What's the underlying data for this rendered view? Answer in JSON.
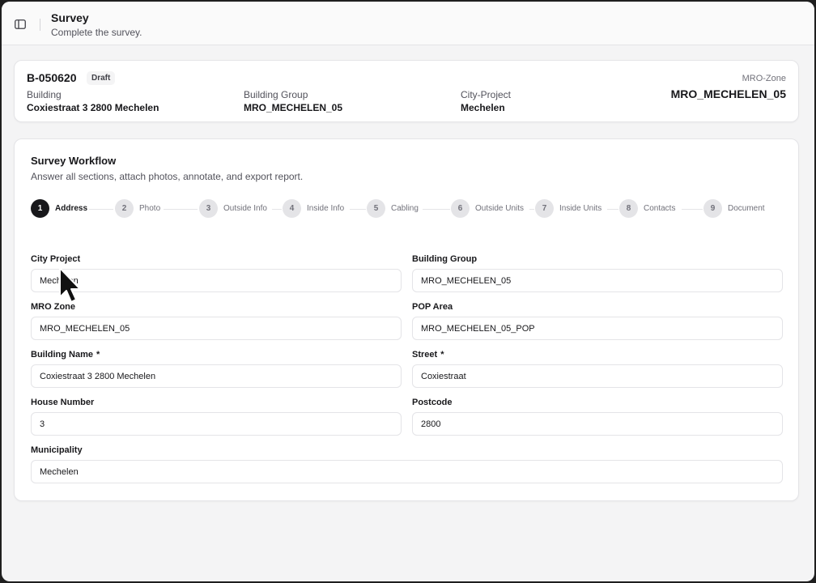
{
  "header": {
    "title": "Survey",
    "subtitle": "Complete the survey.",
    "toggle_icon": "sidebar-toggle-icon"
  },
  "summary": {
    "code": "B-050620",
    "status": "Draft",
    "building_label": "Building",
    "building_value": "Coxiestraat 3 2800 Mechelen",
    "group_label": "Building Group",
    "group_value": "MRO_MECHELEN_05",
    "city_label": "City-Project",
    "city_value": "Mechelen",
    "zone_label": "MRO-Zone",
    "zone_value": "MRO_MECHELEN_05"
  },
  "workflow": {
    "title": "Survey Workflow",
    "subtitle": "Answer all sections, attach photos, annotate, and export report.",
    "steps": [
      {
        "num": "1",
        "label": "Address"
      },
      {
        "num": "2",
        "label": "Photo"
      },
      {
        "num": "3",
        "label": "Outside Info"
      },
      {
        "num": "4",
        "label": "Inside Info"
      },
      {
        "num": "5",
        "label": "Cabling"
      },
      {
        "num": "6",
        "label": "Outside Units"
      },
      {
        "num": "7",
        "label": "Inside Units"
      },
      {
        "num": "8",
        "label": "Contacts"
      },
      {
        "num": "9",
        "label": "Document"
      }
    ],
    "active_step": 1
  },
  "form": {
    "city_project": {
      "label": "City Project",
      "value": "Mechelen"
    },
    "building_group": {
      "label": "Building Group",
      "value": "MRO_MECHELEN_05"
    },
    "mro_zone": {
      "label": "MRO Zone",
      "value": "MRO_MECHELEN_05"
    },
    "pop_area": {
      "label": "POP Area",
      "value": "MRO_MECHELEN_05_POP"
    },
    "building_name": {
      "label": "Building Name",
      "required": "*",
      "value": "Coxiestraat 3 2800 Mechelen"
    },
    "street": {
      "label": "Street",
      "required": "*",
      "value": "Coxiestraat"
    },
    "house_number": {
      "label": "House Number",
      "value": "3"
    },
    "postcode": {
      "label": "Postcode",
      "value": "2800"
    },
    "municipality": {
      "label": "Municipality",
      "value": "Mechelen"
    }
  },
  "colors": {
    "background": "#f4f4f5",
    "card": "#ffffff",
    "active_step": "#18181b",
    "inactive_step": "#e4e4e7",
    "border": "#e4e4e7"
  }
}
